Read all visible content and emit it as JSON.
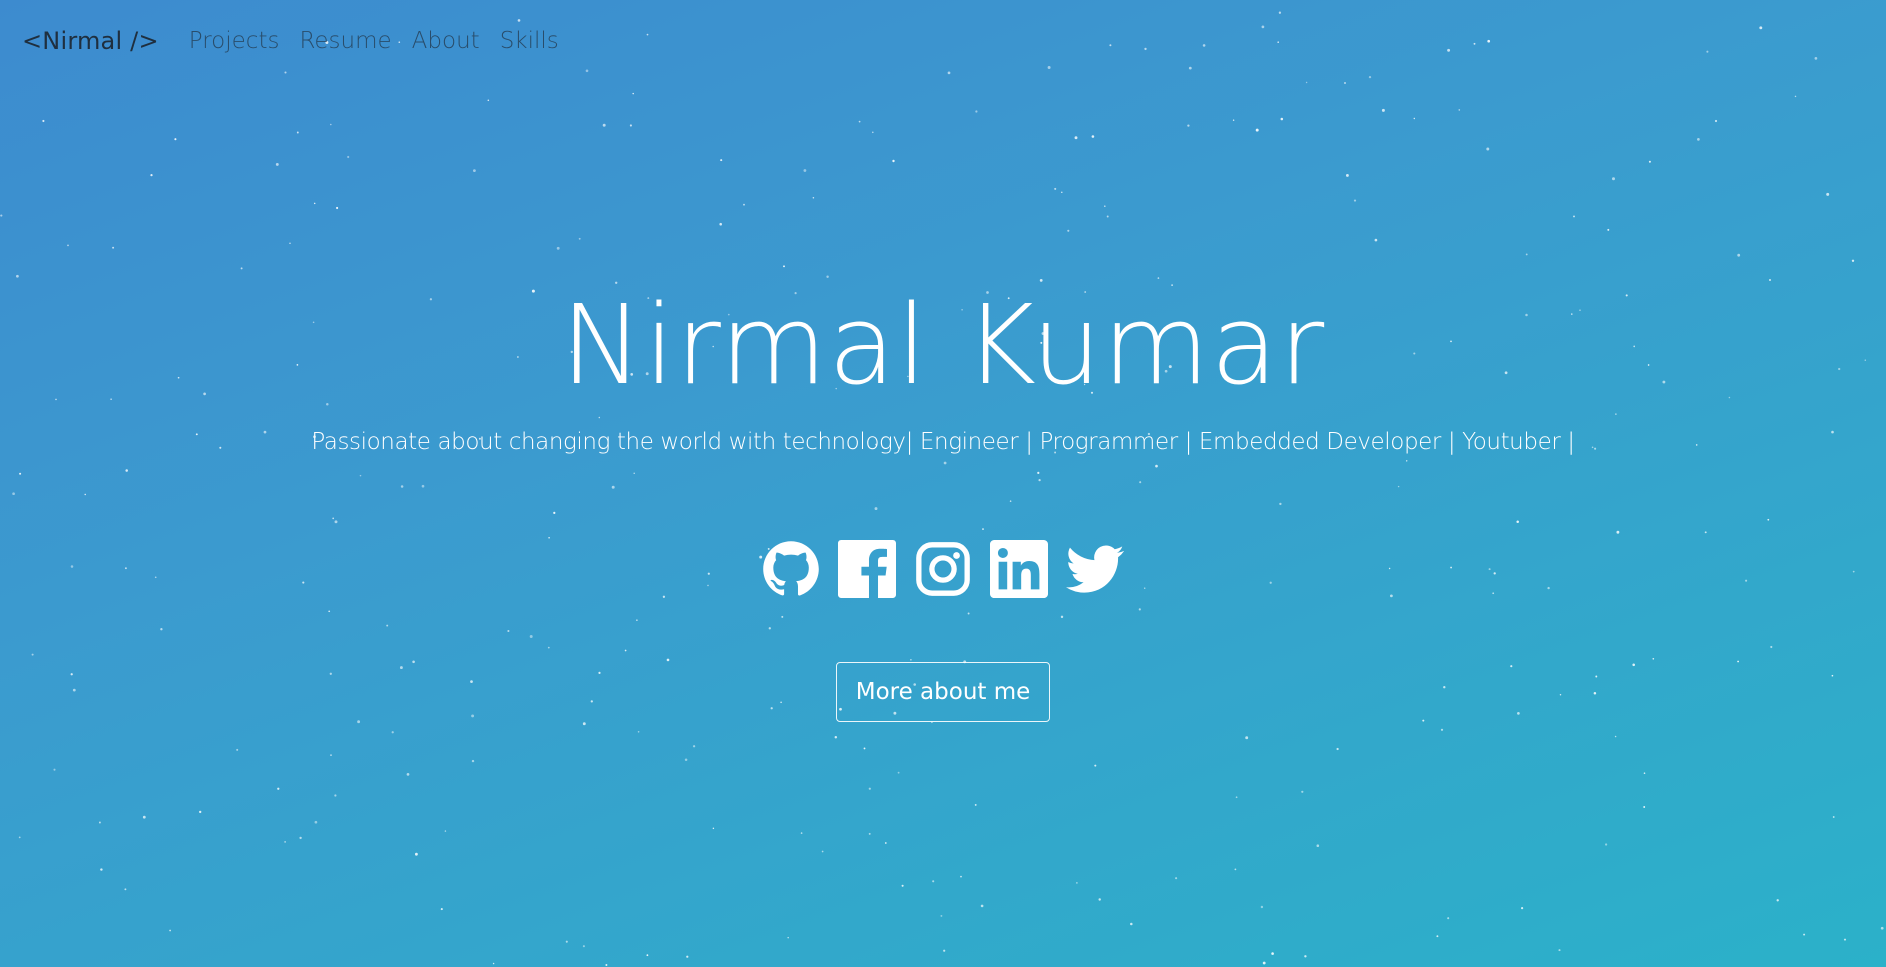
{
  "navbar": {
    "brand": "<Nirmal />",
    "links": [
      "Projects",
      "Resume",
      "About",
      "Skills"
    ]
  },
  "hero": {
    "title": "Nirmal Kumar",
    "subtitle": "Passionate about changing the world with technology| Engineer | Programmer | Embedded Developer | Youtuber |",
    "cta_label": "More about me"
  },
  "social": [
    {
      "name": "github",
      "icon": "github-icon"
    },
    {
      "name": "facebook",
      "icon": "facebook-icon"
    },
    {
      "name": "instagram",
      "icon": "instagram-icon"
    },
    {
      "name": "linkedin",
      "icon": "linkedin-icon"
    },
    {
      "name": "twitter",
      "icon": "twitter-icon"
    }
  ],
  "colors": {
    "gradient_start": "#3d8bcf",
    "gradient_end": "#2bb1c9",
    "brand_text": "#1f2f3f",
    "nav_text": "#26425a",
    "foreground": "#ffffff"
  }
}
